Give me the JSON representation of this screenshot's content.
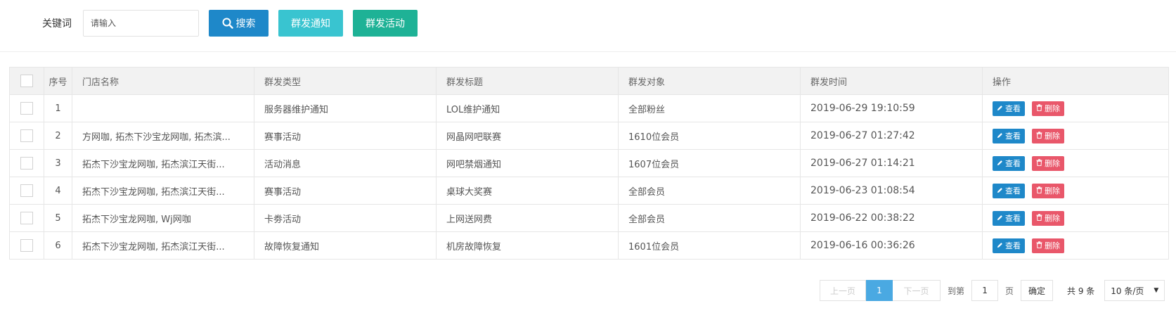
{
  "toolbar": {
    "keyword_label": "关键词",
    "keyword_placeholder": "请输入",
    "search_label": "搜索",
    "notice_label": "群发通知",
    "activity_label": "群发活动"
  },
  "table": {
    "headers": [
      "序号",
      "门店名称",
      "群发类型",
      "群发标题",
      "群发对象",
      "群发时间",
      "操作"
    ],
    "rows": [
      {
        "no": "1",
        "store": "",
        "type": "服务器维护通知",
        "title": "LOL维护通知",
        "target": "全部粉丝",
        "time": "2019-06-29 19:10:59"
      },
      {
        "no": "2",
        "store": "方网咖, 拓杰下沙宝龙网咖, 拓杰滨...",
        "type": "赛事活动",
        "title": "网晶网吧联赛",
        "target": "1610位会员",
        "time": "2019-06-27 01:27:42"
      },
      {
        "no": "3",
        "store": "拓杰下沙宝龙网咖, 拓杰滨江天街...",
        "type": "活动消息",
        "title": "网吧禁烟通知",
        "target": "1607位会员",
        "time": "2019-06-27 01:14:21"
      },
      {
        "no": "4",
        "store": "拓杰下沙宝龙网咖, 拓杰滨江天街...",
        "type": "赛事活动",
        "title": "桌球大奖赛",
        "target": "全部会员",
        "time": "2019-06-23 01:08:54"
      },
      {
        "no": "5",
        "store": "拓杰下沙宝龙网咖, Wj网咖",
        "type": "卡劵活动",
        "title": "上网送网费",
        "target": "全部会员",
        "time": "2019-06-22 00:38:22"
      },
      {
        "no": "6",
        "store": "拓杰下沙宝龙网咖, 拓杰滨江天街...",
        "type": "故障恢复通知",
        "title": "机房故障恢复",
        "target": "1601位会员",
        "time": "2019-06-16 00:36:26"
      }
    ],
    "view_label": "查看",
    "delete_label": "删除"
  },
  "pager": {
    "prev": "上一页",
    "current": "1",
    "next": "下一页",
    "goto_label": "到第",
    "goto_value": "1",
    "page_unit": "页",
    "confirm": "确定",
    "total": "共 9 条",
    "page_size": "10 条/页"
  },
  "colors": {
    "primary": "#1e88c9",
    "notice": "#39c4d0",
    "activity": "#1eb296",
    "danger": "#e9576a",
    "page_active": "#4aa9e2"
  }
}
